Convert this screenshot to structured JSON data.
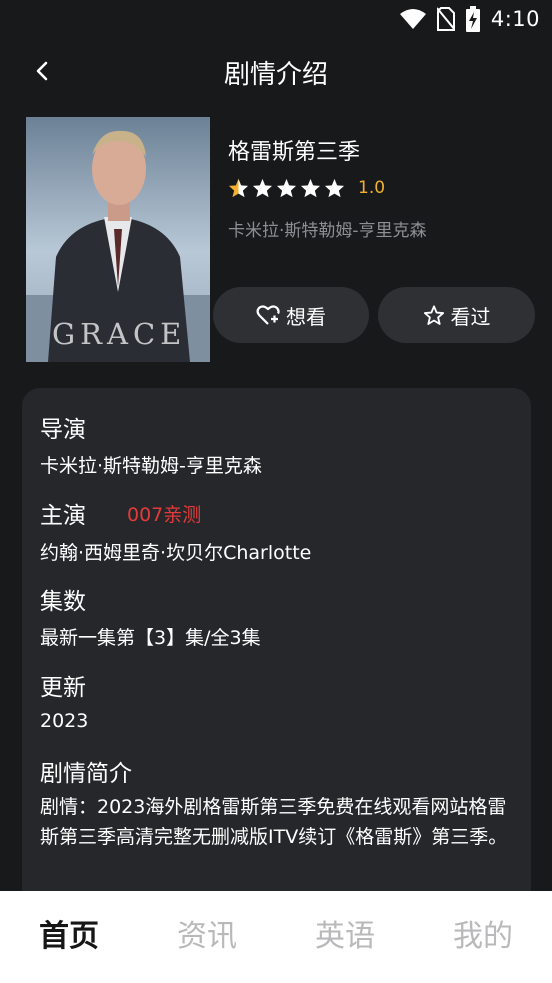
{
  "status_bar": {
    "time": "4:10",
    "icons": [
      "wifi-icon",
      "no-sim-icon",
      "battery-charging-icon"
    ]
  },
  "header": {
    "title": "剧情介绍",
    "back_icon": "chevron-left-icon"
  },
  "poster": {
    "caption": "GRACE"
  },
  "show": {
    "title": "格雷斯第三季",
    "rating": "1.0",
    "rating_stars": 1,
    "director_summary": "卡米拉·斯特勒姆-亨里克森"
  },
  "actions": {
    "want_label": "想看",
    "want_icon": "heart-plus-icon",
    "seen_label": "看过",
    "seen_icon": "star-outline-icon"
  },
  "details": {
    "director_label": "导演",
    "director_value": "卡米拉·斯特勒姆-亨里克森",
    "cast_label": "主演",
    "cast_badge": "007亲测",
    "cast_value": "约翰·西姆里奇·坎贝尔Charlotte",
    "episodes_label": "集数",
    "episodes_value": "最新一集第【3】集/全3集",
    "update_label": "更新",
    "update_value": "2023",
    "plot_label": "剧情简介",
    "plot_value": "剧情：2023海外剧格雷斯第三季免费在线观看网站格雷斯第三季高清完整无删减版ITV续订《格雷斯》第三季。"
  },
  "tabs": [
    {
      "label": "首页",
      "active": true
    },
    {
      "label": "资讯",
      "active": false
    },
    {
      "label": "英语",
      "active": false
    },
    {
      "label": "我的",
      "active": false
    }
  ],
  "colors": {
    "background": "#18191b",
    "card": "#26272b",
    "pill": "#2e3034",
    "star_active": "#f3b12f",
    "star_inactive": "#ffffff",
    "badge_red": "#e53a3a",
    "muted_text": "#8c8f94"
  }
}
